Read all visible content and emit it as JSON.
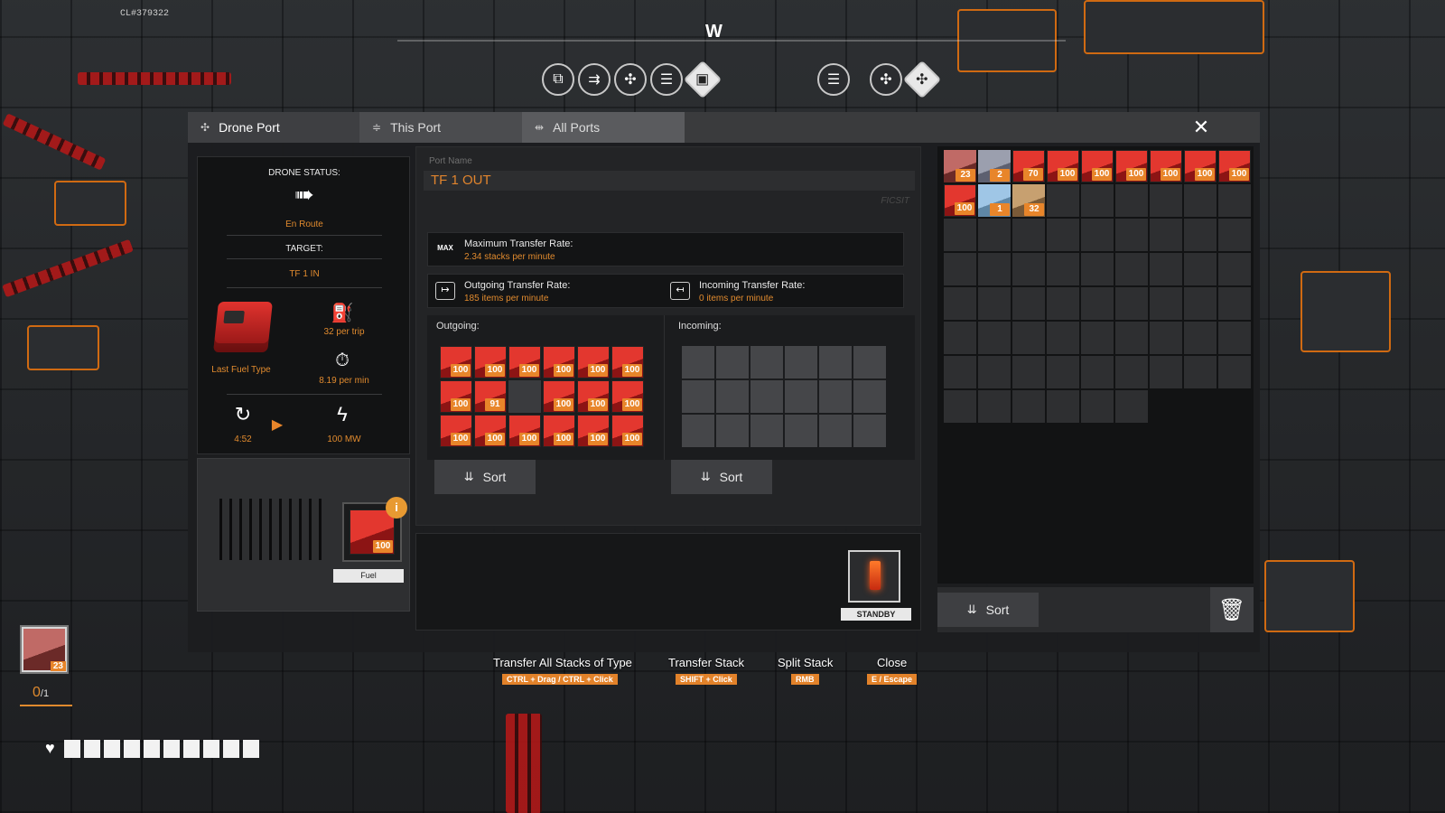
{
  "hud": {
    "build_label": "CL#379322",
    "compass_letter": "W",
    "hotbar_left": [
      "conveyor-icon",
      "splitter-icon",
      "drone-port-icon",
      "storage-icon",
      "blueprint-icon"
    ],
    "hotbar_right": [
      "storage-icon",
      "drone-port-icon",
      "transfer-icon"
    ],
    "held_item_count": "23",
    "count_value": "0",
    "count_max": "/1",
    "health_segments": 10
  },
  "tabs": [
    {
      "label": "Drone Port",
      "icon": "✣"
    },
    {
      "label": "This Port",
      "icon": "≑"
    },
    {
      "label": "All Ports",
      "icon": "⇹"
    }
  ],
  "close_symbol": "✕",
  "status": {
    "drone_status_label": "DRONE STATUS:",
    "drone_status_value": "En Route",
    "target_label": "TARGET:",
    "target_value": "TF 1 IN",
    "fuel_type_label": "Last Fuel Type",
    "per_trip": "32 per trip",
    "per_min": "8.19 per min",
    "timer": "4:52",
    "power": "100 MW",
    "fuel_slot_count": "100",
    "fuel_slot_label": "Fuel"
  },
  "port": {
    "name_label": "Port Name",
    "name_value": "TF 1 OUT",
    "logo_text": "FICSIT",
    "max_rate_title": "Maximum Transfer Rate:",
    "max_rate_value": "2.34 stacks per minute",
    "max_icon_text": "MAX",
    "outgoing_rate_title": "Outgoing Transfer Rate:",
    "outgoing_rate_value": "185 items per minute",
    "incoming_rate_title": "Incoming Transfer Rate:",
    "incoming_rate_value": "0 items per minute",
    "outgoing_label": "Outgoing:",
    "incoming_label": "Incoming:",
    "outgoing_slots": [
      "100",
      "100",
      "100",
      "100",
      "100",
      "100",
      "100",
      "91",
      "",
      "100",
      "100",
      "100",
      "100",
      "100",
      "100",
      "100",
      "100",
      "100"
    ],
    "incoming_slot_count": 18,
    "sort_label": "Sort",
    "standby_label": "STANDBY"
  },
  "inventory": {
    "items": [
      {
        "count": "23",
        "kind": "pinkish"
      },
      {
        "count": "2",
        "kind": "grey"
      },
      {
        "count": "70",
        "kind": "red"
      },
      {
        "count": "100",
        "kind": "red"
      },
      {
        "count": "100",
        "kind": "red"
      },
      {
        "count": "100",
        "kind": "red"
      },
      {
        "count": "100",
        "kind": "red"
      },
      {
        "count": "100",
        "kind": "red"
      },
      {
        "count": "100",
        "kind": "red"
      },
      {
        "count": "100",
        "kind": "red"
      },
      {
        "count": "1",
        "kind": "blue"
      },
      {
        "count": "32",
        "kind": "tan"
      }
    ],
    "total_slots": 69,
    "sort_label": "Sort",
    "trash_icon": "🗑"
  },
  "hints": [
    {
      "title": "Transfer All Stacks of Type",
      "key": "CTRL + Drag / CTRL + Click"
    },
    {
      "title": "Transfer Stack",
      "key": "SHIFT + Click"
    },
    {
      "title": "Split Stack",
      "key": "RMB"
    },
    {
      "title": "Close",
      "key": "E / Escape"
    }
  ],
  "colors": {
    "accent_orange": "#e8852a",
    "panel_dark": "#121314",
    "item_red": "#e3372f"
  }
}
